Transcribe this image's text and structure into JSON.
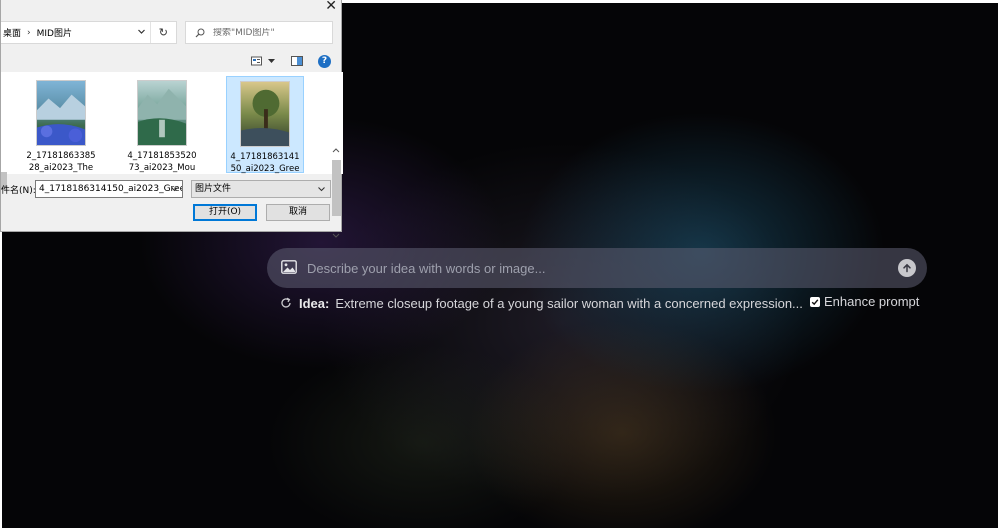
{
  "app": {
    "prompt_placeholder": "Describe your idea with words or image...",
    "idea_label": "Idea:",
    "idea_text": "Extreme closeup footage of a young sailor woman with a concerned expression...",
    "enhance_label": "Enhance prompt",
    "enhance_checked": true
  },
  "dialog": {
    "breadcrumb_root": "桌面",
    "breadcrumb_sep": "›",
    "breadcrumb_folder": "MID图片",
    "search_placeholder": "搜索\"MID图片\"",
    "help_label": "?",
    "files": [
      {
        "name": "2_17181863385\n28_ai2023_The",
        "selected": false
      },
      {
        "name": "4_17181853520\n73_ai2023_Mou",
        "selected": false
      },
      {
        "name": "4_17181863141\n50_ai2023_Gree",
        "selected": true
      }
    ],
    "filename_label": "件名(N):",
    "filename_value": "4_1718186314150_ai2023_Gree",
    "filetype_value": "图片文件",
    "open_label": "打开(O)",
    "cancel_label": "取消"
  }
}
